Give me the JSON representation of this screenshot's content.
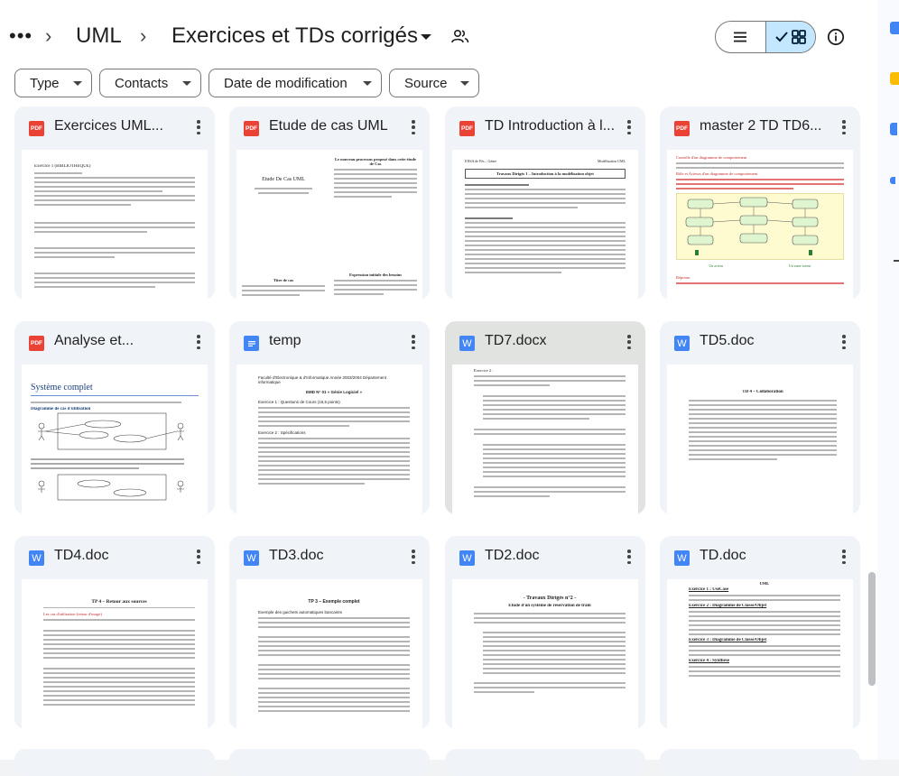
{
  "breadcrumb": {
    "more_label": "•••",
    "parent": "UML",
    "current": "Exercices et TDs corrigés"
  },
  "header_icons": {
    "dropdown": "caret-down-icon",
    "share": "people-icon",
    "list_view": "list-view-icon",
    "grid_view": "grid-view-icon",
    "info": "info-icon"
  },
  "filters": [
    {
      "label": "Type"
    },
    {
      "label": "Contacts"
    },
    {
      "label": "Date de modification"
    },
    {
      "label": "Source"
    }
  ],
  "colors": {
    "pdf": "#ea4335",
    "doc": "#4285f4",
    "selected_toggle": "#c2e7ff",
    "card_bg": "#f0f4f9"
  },
  "files": [
    {
      "title": "Exercices UML...",
      "type": "PDF",
      "preview_heading": "Exercice 1 (BIBLIOTHEQUE)"
    },
    {
      "title": "Etude de cas UML",
      "type": "PDF",
      "preview_heading": "Etude De Cas UML",
      "preview_sub": "Le nouveau processus proposé dans cette étude de Cas",
      "preview_h2": "Titre de cas",
      "preview_h3": "Expression initiale des besoins"
    },
    {
      "title": "TD Introduction à l...",
      "type": "PDF",
      "preview_heading": "Travaux Dirigés 1 – Introduction à la modélisation objet",
      "preview_top_left": "ENSA de Fès – Génie",
      "preview_top_right": "Modélisation UML"
    },
    {
      "title": "master 2 TD TD6...",
      "type": "PDF",
      "preview_heading": "Contrôle d'un diagramme de comportement",
      "preview_sub": "Rôle et Acteurs d'un diagramme de comportement",
      "preview_h2": "Un acteur",
      "preview_h3": "Un autre acteur",
      "preview_footer": "Réponse"
    },
    {
      "title": "Analyse et...",
      "type": "PDF",
      "preview_heading": "Système complet",
      "preview_sub": "Diagramme de cas d'utilisation"
    },
    {
      "title": "temp",
      "type": "DOC",
      "preview_heading": "Faculté d'Electronique & d'Informatique Année 2003/2004 Département informatique",
      "preview_sub": "EMD N° 01 « Génie Logiciel »",
      "preview_h2": "Exercice 1 : Questions de Cours (16,5 points)",
      "preview_h3": "Exercice 2 : Spécifications"
    },
    {
      "title": "TD7.docx",
      "type": "W",
      "preview_heading": "Exercice 2 :"
    },
    {
      "title": "TD5.doc",
      "type": "W",
      "preview_heading": "TD 4 – Collaboration"
    },
    {
      "title": "TD4.doc",
      "type": "W",
      "preview_heading": "TP 4 – Retour aux sources",
      "preview_sub": "Les cas d'utilisation (retour d'usage)"
    },
    {
      "title": "TD3.doc",
      "type": "W",
      "preview_heading": "TP 3 – Exemple complet",
      "preview_sub": "Exemple des guichets automatiques bancaires"
    },
    {
      "title": "TD2.doc",
      "type": "W",
      "preview_heading": "- Travaux Dirigés n°2 -",
      "preview_sub": "Étude d'un système de réservation de train"
    },
    {
      "title": "TD.doc",
      "type": "W",
      "preview_heading": "UML",
      "preview_sub": "Exercice 1 : UseCase",
      "preview_h2": "Exercice 2 : Diagramme de Classe/Objet",
      "preview_h3": "Exercice 3 : Diagramme de Classe/Objet",
      "preview_footer": "Exercice 4 : Synthèse"
    }
  ]
}
